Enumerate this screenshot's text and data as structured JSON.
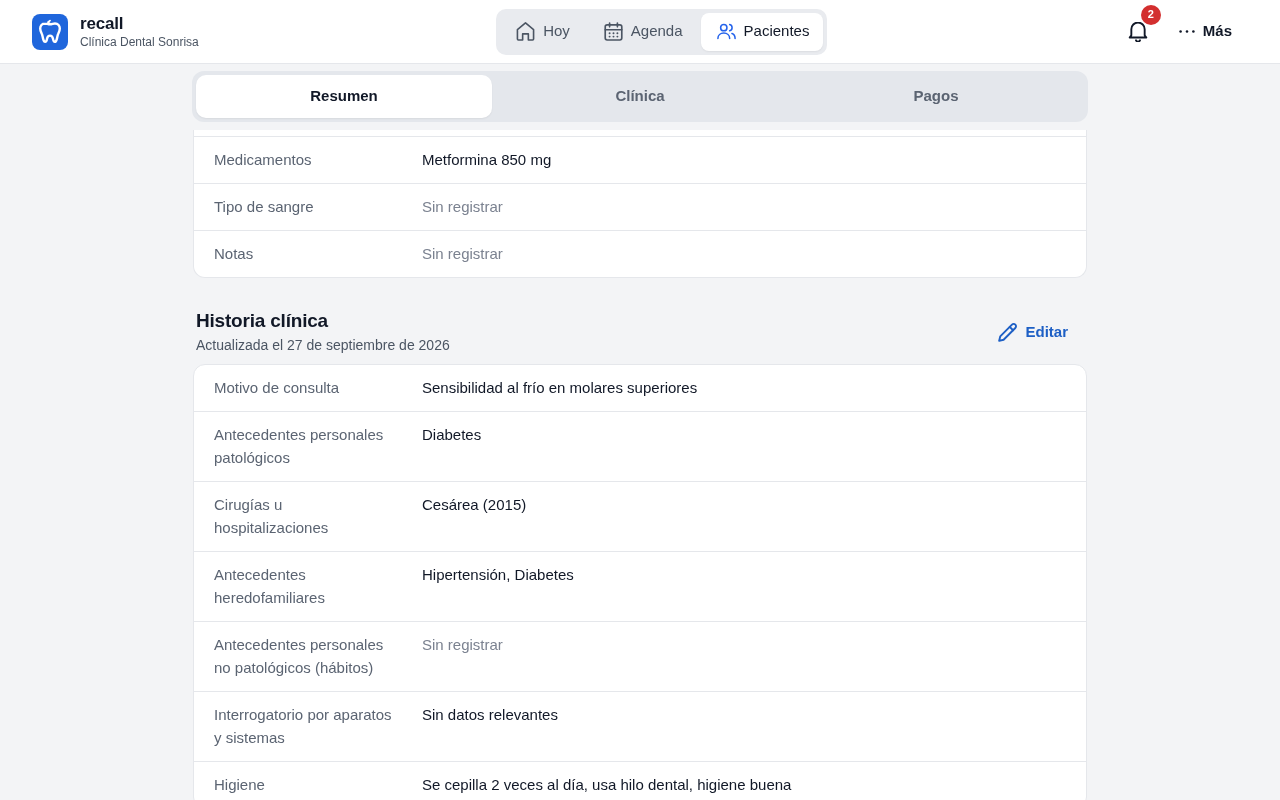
{
  "header": {
    "app_name": "recall",
    "clinic": "Clínica Dental Sonrisa",
    "nav": [
      {
        "label": "Hoy",
        "kind": "home",
        "selected": false
      },
      {
        "label": "Agenda",
        "kind": "calendar",
        "selected": false
      },
      {
        "label": "Pacientes",
        "kind": "people",
        "selected": true
      }
    ],
    "notifications": "2",
    "more_label": "Más"
  },
  "tabs": [
    {
      "label": "Resumen",
      "selected": true
    },
    {
      "label": "Clínica",
      "selected": false
    },
    {
      "label": "Pagos",
      "selected": false
    }
  ],
  "summary": {
    "rows": [
      {
        "label": "Medicamentos",
        "value": "Metformina 850 mg",
        "muted": false
      },
      {
        "label": "Tipo de sangre",
        "value": "Sin registrar",
        "muted": true
      },
      {
        "label": "Notas",
        "value": "Sin registrar",
        "muted": true
      }
    ]
  },
  "clinical_history": {
    "title": "Historia clínica",
    "updated": "Actualizada el 27 de septiembre de 2026",
    "edit_label": "Editar",
    "rows": [
      {
        "label": "Motivo de consulta",
        "value": "Sensibilidad al frío en molares superiores",
        "muted": false
      },
      {
        "label": "Antecedentes personales patológicos",
        "value": "Diabetes",
        "muted": false
      },
      {
        "label": "Cirugías u hospitalizaciones",
        "value": "Cesárea (2015)",
        "muted": false
      },
      {
        "label": "Antecedentes heredofamiliares",
        "value": "Hipertensión, Diabetes",
        "muted": false
      },
      {
        "label": "Antecedentes personales no patológicos (hábitos)",
        "value": "Sin registrar",
        "muted": true
      },
      {
        "label": "Interrogatorio por aparatos y sistemas",
        "value": "Sin datos relevantes",
        "muted": false
      },
      {
        "label": "Higiene",
        "value": "Se cepilla 2 veces al día, usa hilo dental, higiene buena",
        "muted": false
      }
    ]
  }
}
